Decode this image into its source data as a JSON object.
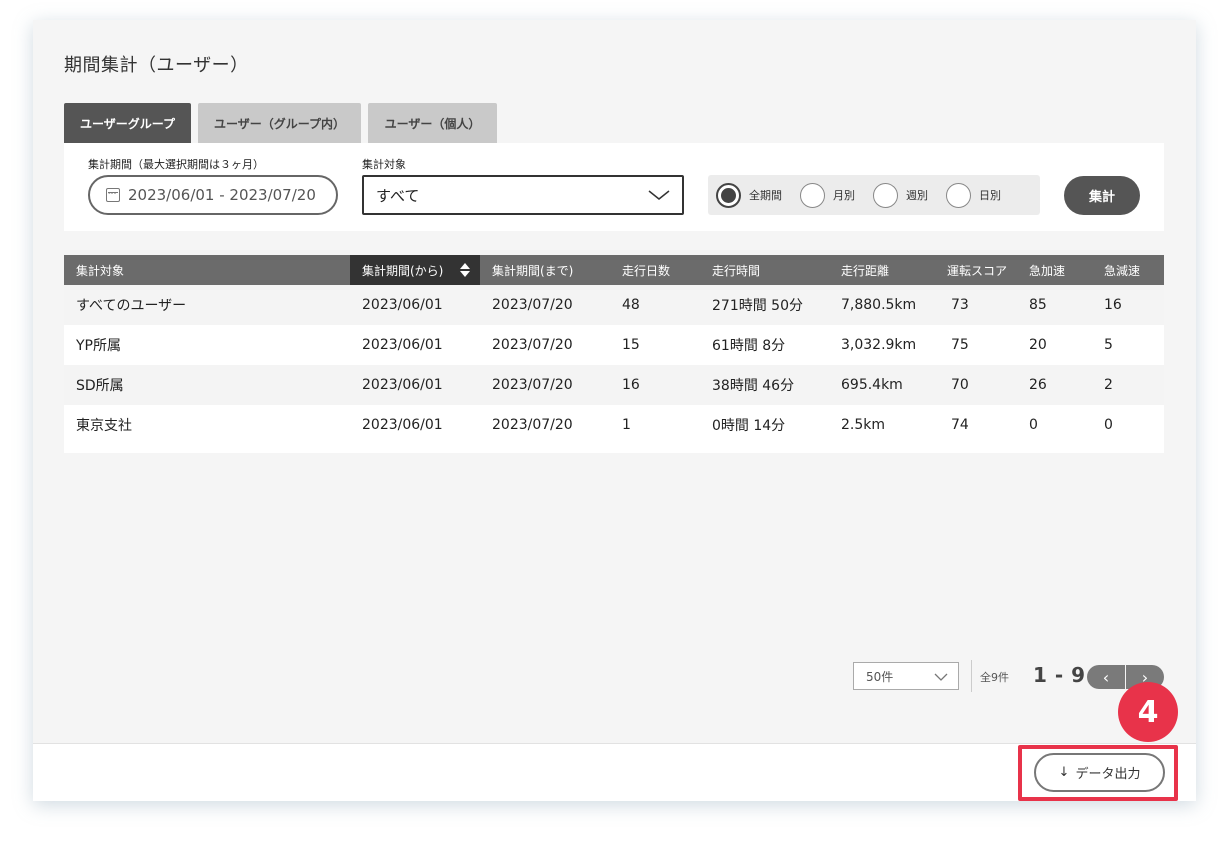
{
  "page": {
    "title": "期間集計（ユーザー）"
  },
  "tabs": [
    {
      "label": "ユーザーグループ",
      "active": true
    },
    {
      "label": "ユーザー（グループ内）",
      "active": false
    },
    {
      "label": "ユーザー（個人）",
      "active": false
    }
  ],
  "filter": {
    "period_label": "集計期間（最大選択期間は３ヶ月）",
    "period_value": "2023/06/01 - 2023/07/20",
    "target_label": "集計対象",
    "target_value": "すべて",
    "radio_options": [
      {
        "label": "全期間",
        "checked": true
      },
      {
        "label": "月別",
        "checked": false
      },
      {
        "label": "週別",
        "checked": false
      },
      {
        "label": "日別",
        "checked": false
      }
    ],
    "submit_label": "集計"
  },
  "table": {
    "headers": [
      "集計対象",
      "集計期間(から)",
      "集計期間(まで)",
      "走行日数",
      "走行時間",
      "走行距離",
      "運転スコア",
      "急加速",
      "急減速"
    ],
    "rows": [
      [
        "すべてのユーザー",
        "2023/06/01",
        "2023/07/20",
        "48",
        "271時間 50分",
        "7,880.5km",
        "73",
        "85",
        "16"
      ],
      [
        "YP所属",
        "2023/06/01",
        "2023/07/20",
        "15",
        "61時間 8分",
        "3,032.9km",
        "75",
        "20",
        "5"
      ],
      [
        "SD所属",
        "2023/06/01",
        "2023/07/20",
        "16",
        "38時間 46分",
        "695.4km",
        "70",
        "26",
        "2"
      ],
      [
        "東京支社",
        "2023/06/01",
        "2023/07/20",
        "1",
        "0時間 14分",
        "2.5km",
        "74",
        "0",
        "0"
      ]
    ]
  },
  "pagination": {
    "per_page": "50件",
    "total": "全9件",
    "range": "1 - 9",
    "prev": "‹",
    "next": "›"
  },
  "export": {
    "label": "データ出力",
    "icon": "↓"
  },
  "annotation": {
    "step": "4",
    "color": "#e8334a"
  }
}
